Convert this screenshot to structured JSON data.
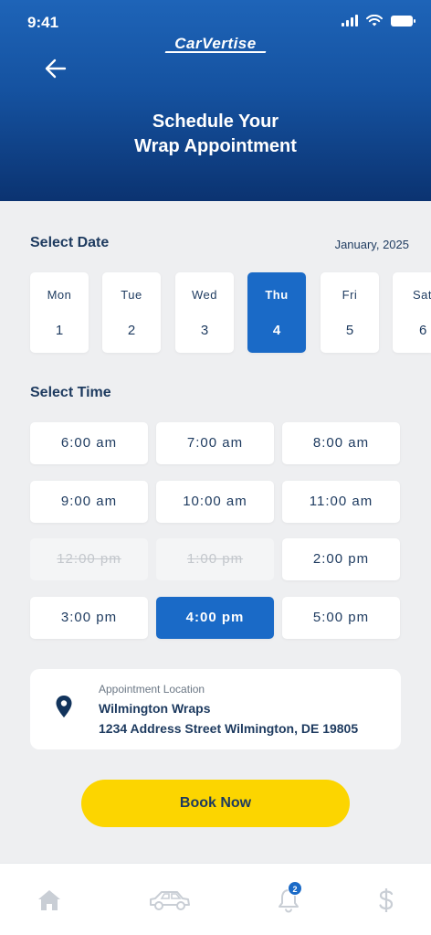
{
  "status_bar": {
    "time": "9:41"
  },
  "header": {
    "logo_text": "CarVertise",
    "title_line1": "Schedule Your",
    "title_line2": "Wrap Appointment"
  },
  "date_section": {
    "label": "Select Date",
    "month": "January, 2025",
    "days": [
      {
        "name": "Mon",
        "num": "1"
      },
      {
        "name": "Tue",
        "num": "2"
      },
      {
        "name": "Wed",
        "num": "3"
      },
      {
        "name": "Thu",
        "num": "4",
        "selected": true
      },
      {
        "name": "Fri",
        "num": "5"
      },
      {
        "name": "Sat",
        "num": "6"
      }
    ]
  },
  "time_section": {
    "label": "Select Time",
    "slots": [
      {
        "label": "6:00 am"
      },
      {
        "label": "7:00 am"
      },
      {
        "label": "8:00 am"
      },
      {
        "label": "9:00 am"
      },
      {
        "label": "10:00 am"
      },
      {
        "label": "11:00 am"
      },
      {
        "label": "12:00 pm",
        "disabled": true
      },
      {
        "label": "1:00 pm",
        "disabled": true
      },
      {
        "label": "2:00 pm"
      },
      {
        "label": "3:00 pm"
      },
      {
        "label": "4:00 pm",
        "selected": true
      },
      {
        "label": "5:00 pm"
      }
    ]
  },
  "location": {
    "caption": "Appointment Location",
    "name": "Wilmington Wraps",
    "address": "1234 Address Street Wilmington, DE 19805"
  },
  "book_button": {
    "label": "Book Now"
  },
  "tab_bar": {
    "items": [
      {
        "icon": "home-icon"
      },
      {
        "icon": "car-icon"
      },
      {
        "icon": "bell-icon",
        "badge": "2"
      },
      {
        "icon": "dollar-icon"
      }
    ]
  },
  "colors": {
    "accent": "#1a6ac7",
    "header_dark": "#0b3371",
    "cta": "#fcd500",
    "text": "#1d3a5f"
  }
}
